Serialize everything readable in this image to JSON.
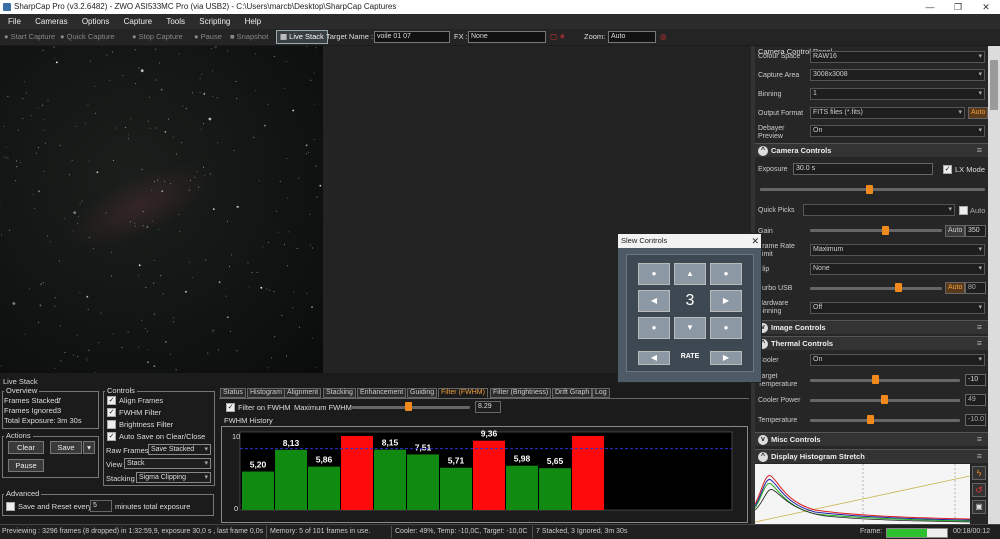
{
  "window": {
    "title": "SharpCap Pro (v3.2.6482) - ZWO ASI533MC Pro (via USB2) - C:\\Users\\marcb\\Desktop\\SharpCap Captures",
    "min": "—",
    "max": "❐",
    "close": "✕"
  },
  "menu": [
    "File",
    "Cameras",
    "Options",
    "Capture",
    "Tools",
    "Scripting",
    "Help"
  ],
  "toolbar": {
    "start_capture": "Start Capture",
    "quick_capture": "Quick Capture",
    "stop_capture": "Stop Capture",
    "pause": "Pause",
    "snapshot": "Snapshot",
    "live_stack": "Live Stack",
    "target_label": "Target Name :",
    "target_value": "voile 01 07",
    "fx_label": "FX :",
    "fx_value": "None",
    "zoom_label": "Zoom:",
    "zoom_value": "Auto"
  },
  "right_panel": {
    "title": "Camera Control Panel",
    "colour_space_label": "Colour Space",
    "colour_space_value": "RAW16",
    "capture_area_label": "Capture Area",
    "capture_area_value": "3008x3008",
    "binning_label": "Binning",
    "binning_value": "1",
    "output_format_label": "Output Format",
    "output_format_value": "FITS files (*.fits)",
    "auto": "Auto",
    "debayer_label": "Debayer Preview",
    "debayer_value": "On",
    "camera_controls": "Camera Controls",
    "exposure_label": "Exposure",
    "exposure_value": "30.0 s",
    "lx_mode": "LX Mode",
    "lx_check": "✓",
    "quick_picks_label": "Quick Picks",
    "gain_label": "Gain",
    "gain_value": "350",
    "frame_rate_label": "Frame Rate Limit",
    "frame_rate_value": "Maximum",
    "flip_label": "Flip",
    "flip_value": "None",
    "turbo_label": "Turbo USB",
    "turbo_value": "80",
    "hw_binning_label": "Hardware Binning",
    "hw_binning_value": "Off",
    "image_controls": "Image Controls",
    "thermal_controls": "Thermal Controls",
    "cooler_label": "Cooler",
    "cooler_value": "On",
    "target_temp_label": "Target Temperature",
    "target_temp_value": "-10",
    "cooler_power_label": "Cooler Power",
    "cooler_power_value": "49",
    "temperature_label": "Temperature",
    "temperature_value": "-10.0",
    "misc_controls": "Misc Controls",
    "histogram_title": "Display Histogram Stretch"
  },
  "live_stack": {
    "title": "Live Stack",
    "overview": "Overview",
    "frames_stacked_label": "Frames Stacked:",
    "frames_stacked": "7",
    "frames_ignored_label": "Frames Ignored:",
    "frames_ignored": "3",
    "total_exposure_label": "Total Exposure:",
    "total_exposure": "3m 30s",
    "actions": "Actions",
    "clear": "Clear",
    "save": "Save",
    "pause": "Pause",
    "advanced": "Advanced",
    "save_reset_label": "Save and Reset every",
    "save_reset_value": "5",
    "save_reset_suffix": "minutes total exposure",
    "controls": "Controls",
    "align_frames": "Align Frames",
    "fwhm_filter": "FWHM Filter",
    "brightness_filter": "Brightness Filter",
    "auto_save": "Auto Save on Clear/Close",
    "check": "✓",
    "raw_frames_label": "Raw Frames",
    "raw_frames_value": "Save Stacked",
    "view_label": "View",
    "view_value": "Stack",
    "stacking_label": "Stacking",
    "stacking_value": "Sigma Clipping"
  },
  "tabs": [
    "Status",
    "Histogram",
    "Alignment",
    "Stacking",
    "Enhancement",
    "Guiding",
    "Filter (FWHM)",
    "Filter (Brightness)",
    "Drift Graph",
    "Log"
  ],
  "fwhm": {
    "filter_label": "Filter on FWHM",
    "max_label": "Maximum FWHM",
    "max_value": "8.29",
    "history_title": "FWHM History"
  },
  "chart_data": {
    "type": "bar",
    "title": "FWHM History",
    "ylim": [
      0,
      10
    ],
    "yticks": [
      "10",
      "0"
    ],
    "threshold": 8.29,
    "values": [
      5.2,
      8.13,
      5.86,
      10.0,
      8.15,
      7.51,
      5.71,
      9.36,
      5.98,
      5.65,
      10.0
    ],
    "labels": [
      "5,20",
      "8,13",
      "5,86",
      "",
      "8,15",
      "7,51",
      "5,71",
      "9,36",
      "5,98",
      "5,65",
      ""
    ],
    "rejected": [
      false,
      false,
      false,
      true,
      false,
      false,
      false,
      true,
      false,
      false,
      true
    ],
    "colors": {
      "accepted": "#118a11",
      "rejected": "#ff0a0a",
      "threshold": "#3030d0"
    }
  },
  "slew": {
    "title": "Slew Controls",
    "close": "✕",
    "rate_value": "3",
    "rate_label": "RATE",
    "up": "▲",
    "down": "▼",
    "left": "◀",
    "right": "▶",
    "dot": "●"
  },
  "status": {
    "previewing": "Previewing : 3296 frames (8 dropped) in 1:32:59,9, exposure 30,0 s , last frame 0,0s",
    "memory": "Memory: 5 of 101 frames in use.",
    "cooler": "Cooler: 49%, Temp: -10,0C, Target: -10,0C",
    "stack": "7 Stacked, 3 Ignored, 3m 30s",
    "frame_label": "Frame:",
    "elapsed": "00:18/00:12"
  }
}
